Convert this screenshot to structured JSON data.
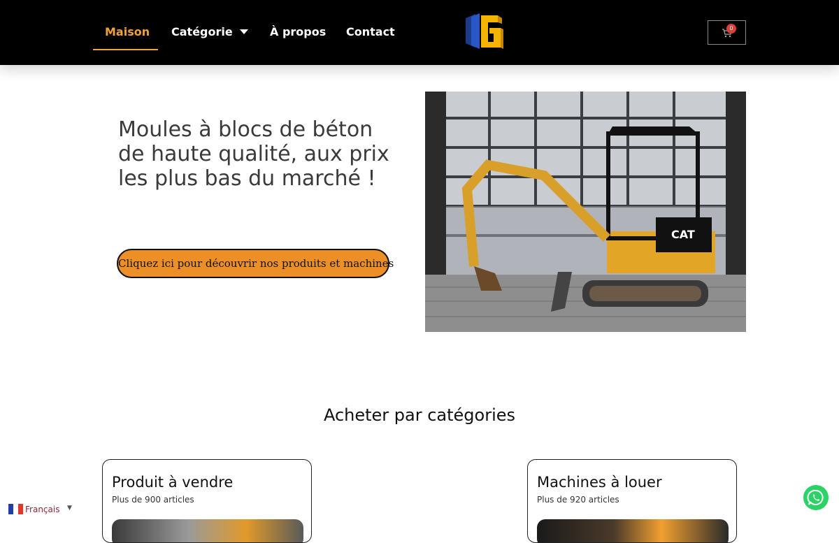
{
  "nav": {
    "items": [
      {
        "label": "Maison",
        "active": true
      },
      {
        "label": "Catégorie",
        "has_dropdown": true
      },
      {
        "label": "À propos"
      },
      {
        "label": "Contact"
      }
    ],
    "logo_icon": "wg-logo-icon",
    "cart": {
      "icon": "cart-icon",
      "count": "0"
    }
  },
  "hero": {
    "title": "Moules à blocs de béton de haute qualité, aux prix les plus bas du marché !",
    "cta_label": "Cliquez ici pour découvrir nos produits et machines",
    "image": "excavator-photo"
  },
  "categories": {
    "heading": "Acheter par catégories",
    "cards": [
      {
        "title": "Produit à vendre",
        "subtitle": "Plus de 900 articles"
      },
      {
        "title": "Machines à louer",
        "subtitle": "Plus de 920 articles"
      }
    ]
  },
  "language": {
    "label": "Français",
    "flag": "france-flag-icon"
  },
  "whatsapp": {
    "icon": "whatsapp-icon"
  },
  "colors": {
    "accent": "#f0a23a",
    "cta": "#ec8f26",
    "navbar": "#000000"
  }
}
